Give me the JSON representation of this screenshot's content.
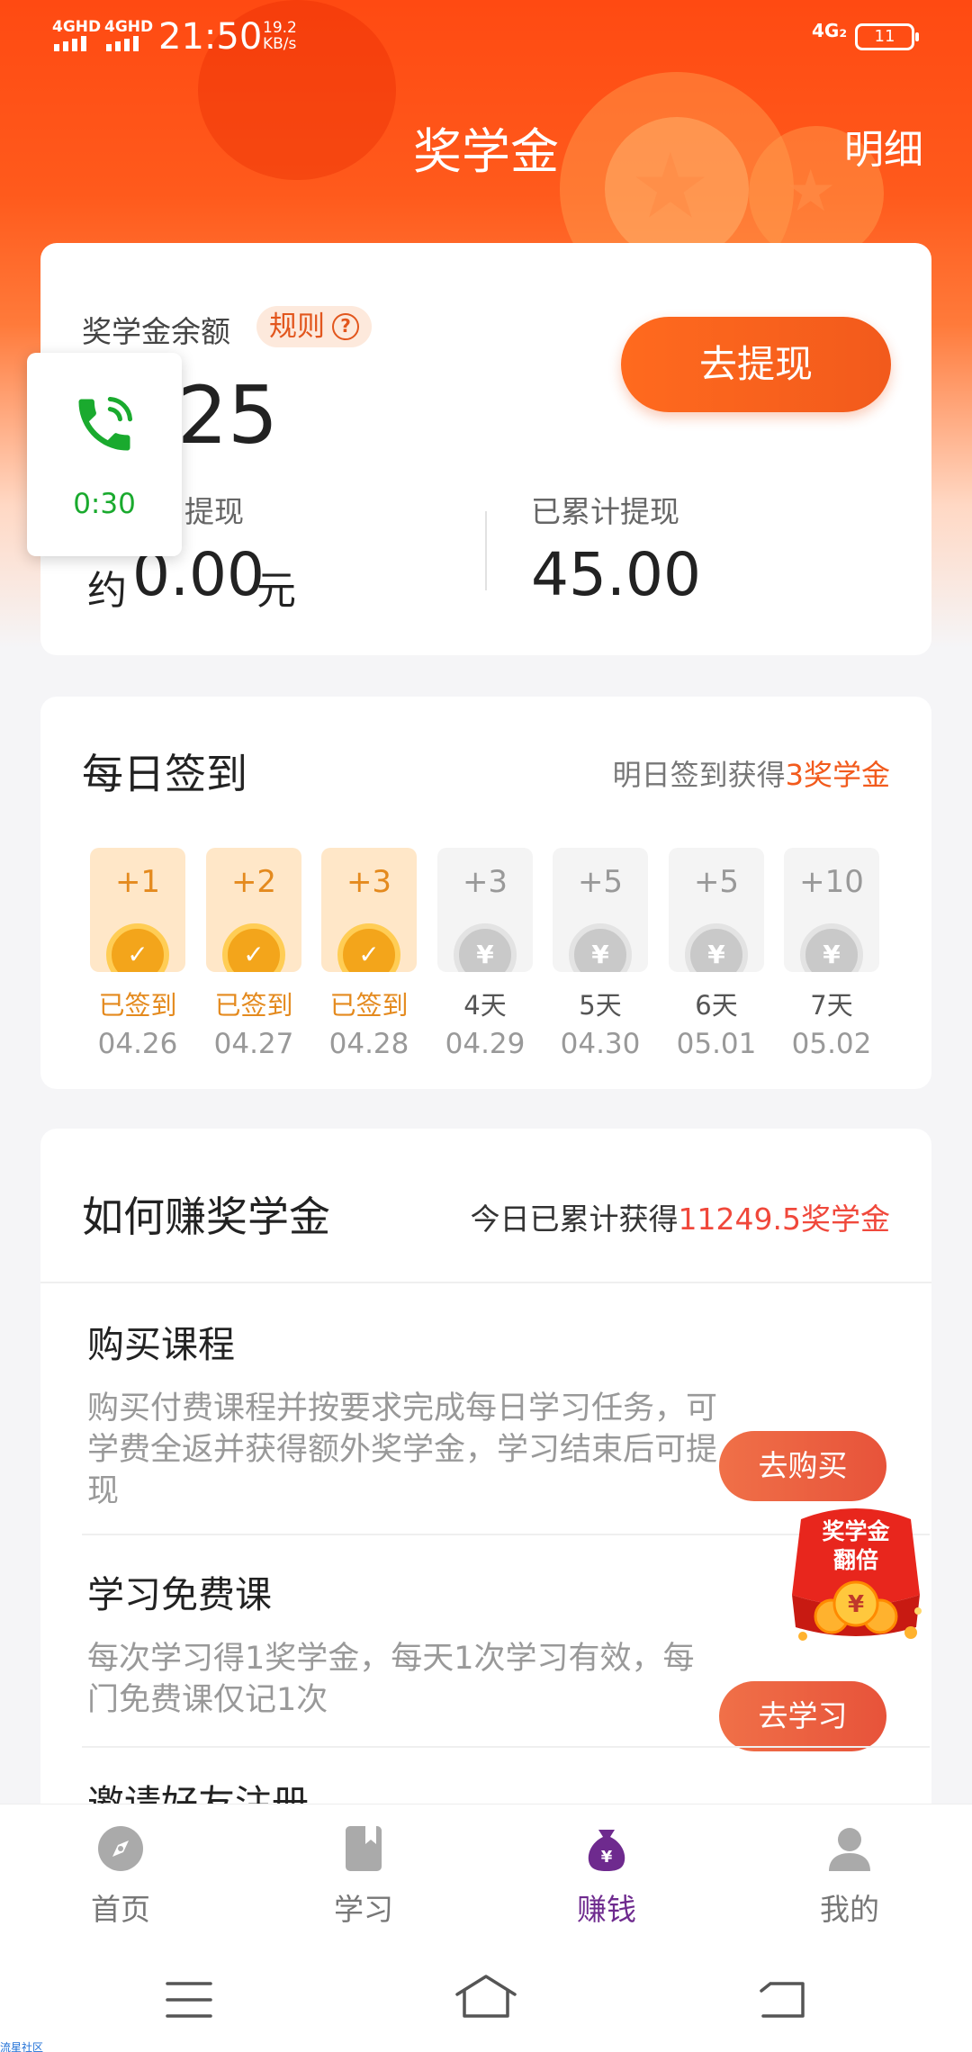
{
  "status_bar": {
    "signal_1": "4GHD",
    "signal_2": "4GHD",
    "time": "21:50",
    "speed_value": "19.2",
    "speed_unit": "KB/s",
    "network": "4G₂",
    "battery": "11"
  },
  "header": {
    "title": "奖学金",
    "detail_link": "明细"
  },
  "balance": {
    "label": "奖学金余额",
    "rule_label": "规则",
    "rule_icon": "?",
    "value": "25",
    "withdraw_button": "去提现",
    "available_label": "提现",
    "available_prefix": "约",
    "available_value": "0.00",
    "available_unit": "元",
    "total_label": "已累计提现",
    "total_value": "45.00"
  },
  "call_overlay": {
    "icon": "phone-call-icon",
    "timer": "0:30"
  },
  "checkin": {
    "title": "每日签到",
    "subtitle_prefix": "明日签到获得",
    "subtitle_highlight": "3奖学金",
    "days": [
      {
        "points": "+1",
        "label": "已签到",
        "date": "04.26",
        "done": true
      },
      {
        "points": "+2",
        "label": "已签到",
        "date": "04.27",
        "done": true
      },
      {
        "points": "+3",
        "label": "已签到",
        "date": "04.28",
        "done": true
      },
      {
        "points": "+3",
        "label": "4天",
        "date": "04.29",
        "done": false
      },
      {
        "points": "+5",
        "label": "5天",
        "date": "04.30",
        "done": false
      },
      {
        "points": "+5",
        "label": "6天",
        "date": "05.01",
        "done": false
      },
      {
        "points": "+10",
        "label": "7天",
        "date": "05.02",
        "done": false
      }
    ],
    "coin_symbol": "¥",
    "check_symbol": "✓"
  },
  "earn": {
    "title": "如何赚奖学金",
    "subtitle_prefix": "今日已累计获得",
    "subtitle_highlight": "11249.5奖学金",
    "tasks": [
      {
        "title": "购买课程",
        "desc": "购买付费课程并按要求完成每日学习任务，可学费全返并获得额外奖学金，学习结束后可提现",
        "button": "去购买"
      },
      {
        "title": "学习免费课",
        "desc": "每次学习得1奖学金，每天1次学习有效，每门免费课仅记1次",
        "button": "去学习"
      },
      {
        "title": "邀请好友注册",
        "desc": "",
        "button": ""
      }
    ]
  },
  "promo": {
    "line1": "奖学金",
    "line2": "翻倍",
    "coin_symbol": "¥"
  },
  "bottom_nav": {
    "items": [
      {
        "label": "首页",
        "icon": "compass-icon"
      },
      {
        "label": "学习",
        "icon": "book-icon"
      },
      {
        "label": "赚钱",
        "icon": "money-bag-icon"
      },
      {
        "label": "我的",
        "icon": "user-icon"
      }
    ],
    "active_index": 2
  },
  "corner_mark": "流星社区",
  "colors": {
    "header_orange": "#ff4a12",
    "accent_orange": "#f25a1c",
    "highlight_red": "#f0483b",
    "checked_gold": "#e48a1e",
    "nav_active": "#6e2a8e",
    "call_green": "#1aaa2e"
  }
}
